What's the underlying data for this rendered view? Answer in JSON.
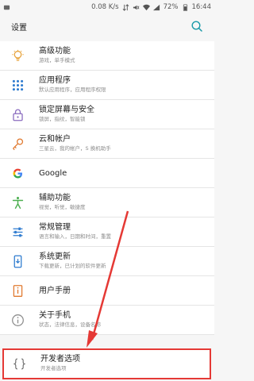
{
  "status": {
    "speed": "0.08 K/s",
    "battery": "72%",
    "time": "16:44"
  },
  "appbar": {
    "title": "设置"
  },
  "items": [
    {
      "title": "高级功能",
      "subtitle": "游戏，单手模式"
    },
    {
      "title": "应用程序",
      "subtitle": "默认应用程序，应用程序权限"
    },
    {
      "title": "锁定屏幕与安全",
      "subtitle": "锁屏，指纹，智能锁"
    },
    {
      "title": "云和帐户",
      "subtitle": "三星云，我的帐户，S 换机助手"
    },
    {
      "title": "Google",
      "subtitle": ""
    },
    {
      "title": "辅助功能",
      "subtitle": "视觉，听觉，敏捷度"
    },
    {
      "title": "常规管理",
      "subtitle": "语言和输入，日期和时间，重置"
    },
    {
      "title": "系统更新",
      "subtitle": "下载更新，已计划的软件更新"
    },
    {
      "title": "用户手册",
      "subtitle": ""
    },
    {
      "title": "关于手机",
      "subtitle": "状态，法律信息，设备名称"
    },
    {
      "title": "开发者选项",
      "subtitle": "开发者选项"
    }
  ],
  "icons": [
    "lightbulb-icon",
    "apps-grid-icon",
    "lock-icon",
    "key-icon",
    "google-g-icon",
    "accessibility-icon",
    "sliders-icon",
    "system-update-icon",
    "user-manual-icon",
    "info-icon",
    "braces-icon"
  ],
  "accent_color": "#e53935"
}
